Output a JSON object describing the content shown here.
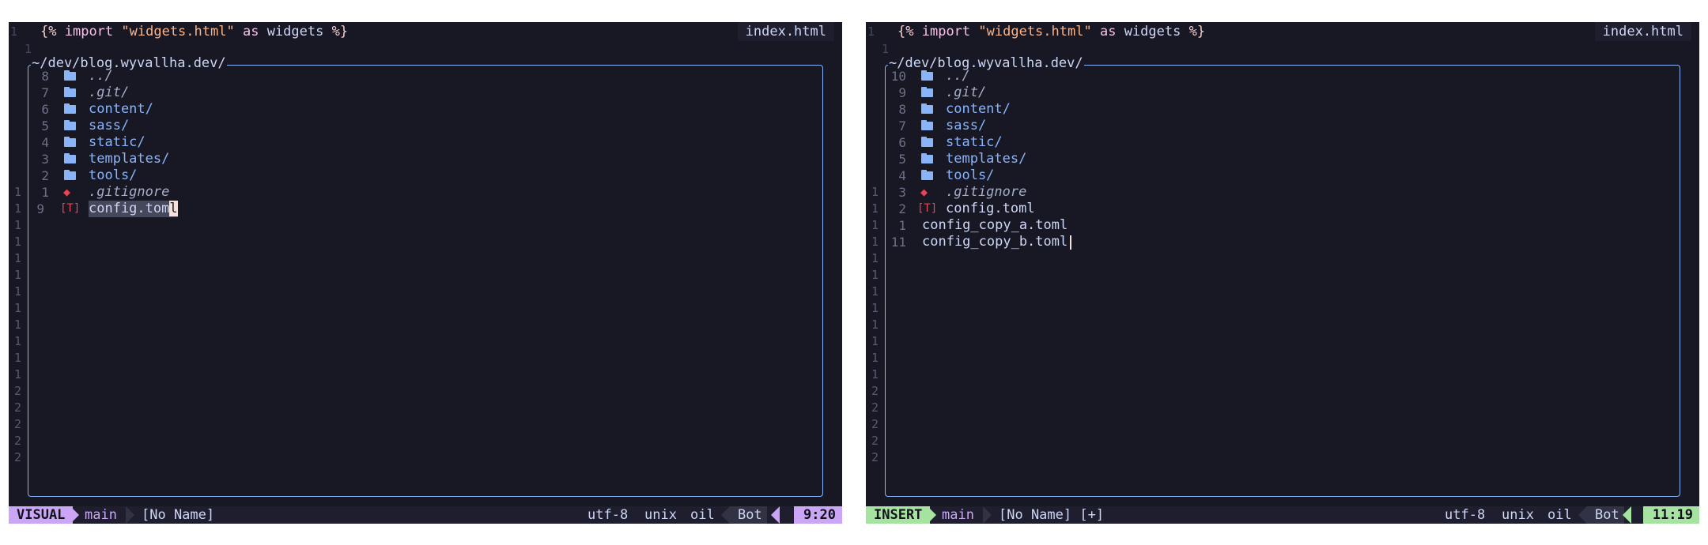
{
  "colors": {
    "visual_mode": "#cba6f7",
    "insert_mode": "#a6e3a1",
    "directory": "#89b4fa",
    "border": "#89b4fa",
    "background": "#181825"
  },
  "left": {
    "top_line_number": "1",
    "import": {
      "open": "{%",
      "keyword1": "import",
      "string": "\"widgets.html\"",
      "keyword2": "as",
      "name": "widgets",
      "close": "%}"
    },
    "file_tab": "index.html",
    "second_line_number": "1",
    "float_title": "~/dev/blog.wyvallha.dev/",
    "entries": [
      {
        "outer": "",
        "num": "8",
        "icon": "folder-icon",
        "name": "../",
        "kind": "hidden-dir"
      },
      {
        "outer": "",
        "num": "7",
        "icon": "folder-icon",
        "name": ".git/",
        "kind": "hidden-dir"
      },
      {
        "outer": "",
        "num": "6",
        "icon": "folder-icon",
        "name": "content/",
        "kind": "dir"
      },
      {
        "outer": "",
        "num": "5",
        "icon": "folder-icon",
        "name": "sass/",
        "kind": "dir"
      },
      {
        "outer": "",
        "num": "4",
        "icon": "folder-icon",
        "name": "static/",
        "kind": "dir"
      },
      {
        "outer": "",
        "num": "3",
        "icon": "folder-icon",
        "name": "templates/",
        "kind": "dir"
      },
      {
        "outer": "",
        "num": "2",
        "icon": "folder-icon",
        "name": "tools/",
        "kind": "dir"
      },
      {
        "outer": "1",
        "num": "1",
        "icon": "git-icon",
        "name": ".gitignore",
        "kind": "hidden-file"
      },
      {
        "outer": "1",
        "num": "9",
        "icon": "toml-icon",
        "name": "config.toml",
        "kind": "file"
      }
    ],
    "outer_numbers": [
      "1",
      "1",
      "1",
      "1",
      "1",
      "1",
      "1",
      "1",
      "1",
      "1",
      "2",
      "2",
      "2",
      "2",
      "2"
    ],
    "status": {
      "mode": "VISUAL",
      "branch": "main",
      "buffer": "[No Name]",
      "encoding": "utf-8",
      "format": "unix",
      "filetype": "oil",
      "scroll": "Bot",
      "position": "9:20"
    }
  },
  "right": {
    "top_line_number": "1",
    "import": {
      "open": "{%",
      "keyword1": "import",
      "string": "\"widgets.html\"",
      "keyword2": "as",
      "name": "widgets",
      "close": "%}"
    },
    "file_tab": "index.html",
    "second_line_number": "1",
    "float_title": "~/dev/blog.wyvallha.dev/",
    "entries": [
      {
        "outer": "",
        "num": "10",
        "icon": "folder-icon",
        "name": "../",
        "kind": "hidden-dir"
      },
      {
        "outer": "",
        "num": "9",
        "icon": "folder-icon",
        "name": ".git/",
        "kind": "hidden-dir"
      },
      {
        "outer": "",
        "num": "8",
        "icon": "folder-icon",
        "name": "content/",
        "kind": "dir"
      },
      {
        "outer": "",
        "num": "7",
        "icon": "folder-icon",
        "name": "sass/",
        "kind": "dir"
      },
      {
        "outer": "",
        "num": "6",
        "icon": "folder-icon",
        "name": "static/",
        "kind": "dir"
      },
      {
        "outer": "",
        "num": "5",
        "icon": "folder-icon",
        "name": "templates/",
        "kind": "dir"
      },
      {
        "outer": "",
        "num": "4",
        "icon": "folder-icon",
        "name": "tools/",
        "kind": "dir"
      },
      {
        "outer": "1",
        "num": "3",
        "icon": "git-icon",
        "name": ".gitignore",
        "kind": "hidden-file"
      },
      {
        "outer": "1",
        "num": "2",
        "icon": "toml-icon",
        "name": "config.toml",
        "kind": "file"
      },
      {
        "outer": "1",
        "num": "1",
        "icon": "",
        "name": "config_copy_a.toml",
        "kind": "file"
      },
      {
        "outer": "1",
        "num": "11",
        "icon": "",
        "name": "config_copy_b.toml",
        "kind": "file"
      }
    ],
    "outer_numbers": [
      "1",
      "1",
      "1",
      "1",
      "1",
      "1",
      "1",
      "1",
      "2",
      "2",
      "2",
      "2",
      "2"
    ],
    "status": {
      "mode": "INSERT",
      "branch": "main",
      "buffer": "[No Name] [+]",
      "encoding": "utf-8",
      "format": "unix",
      "filetype": "oil",
      "scroll": "Bot",
      "position": "11:19"
    }
  }
}
